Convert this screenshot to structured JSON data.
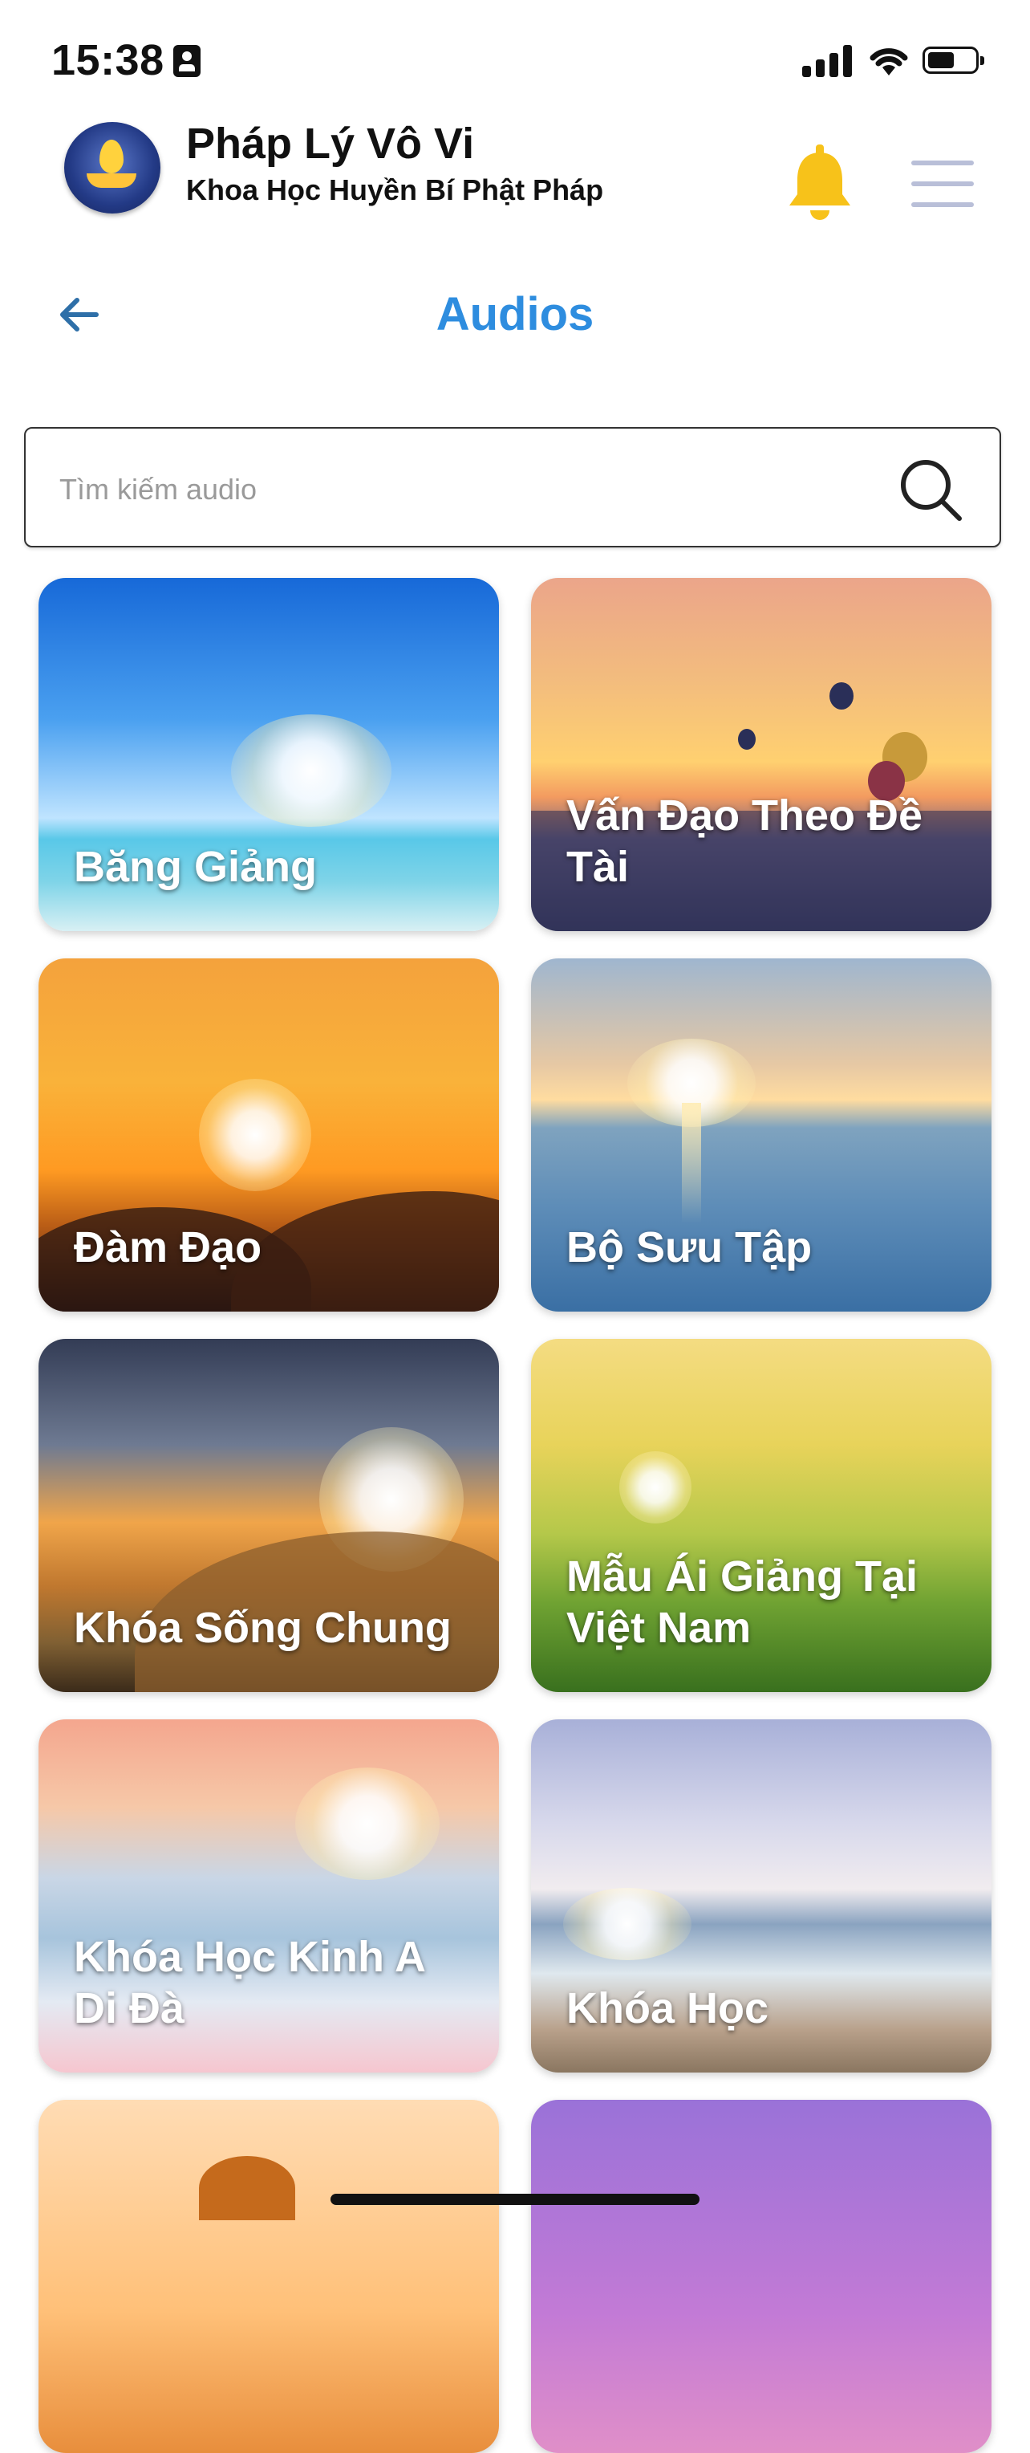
{
  "status_bar": {
    "time": "15:38"
  },
  "header": {
    "app_title": "Pháp Lý Vô Vi",
    "app_subtitle": "Khoa Học Huyền Bí Phật Pháp"
  },
  "nav": {
    "page_title": "Audios"
  },
  "search": {
    "placeholder": "Tìm kiếm audio",
    "value": ""
  },
  "categories": [
    {
      "label": "Băng Giảng"
    },
    {
      "label": "Vấn Đạo Theo Đề Tài"
    },
    {
      "label": "Đàm Đạo"
    },
    {
      "label": "Bộ Sưu Tập"
    },
    {
      "label": "Khóa Sống Chung"
    },
    {
      "label": "Mẫu Ái Giảng Tại Việt Nam"
    },
    {
      "label": "Khóa Học Kinh A Di Đà"
    },
    {
      "label": "Khóa Học"
    }
  ],
  "colors": {
    "accent": "#2e8ddf",
    "bell": "#f7c21a",
    "menu": "#b9bfd8"
  },
  "icons": [
    "id-card-icon",
    "signal-icon",
    "wifi-icon",
    "battery-icon",
    "bell-icon",
    "menu-icon",
    "back-arrow-icon",
    "search-icon"
  ]
}
